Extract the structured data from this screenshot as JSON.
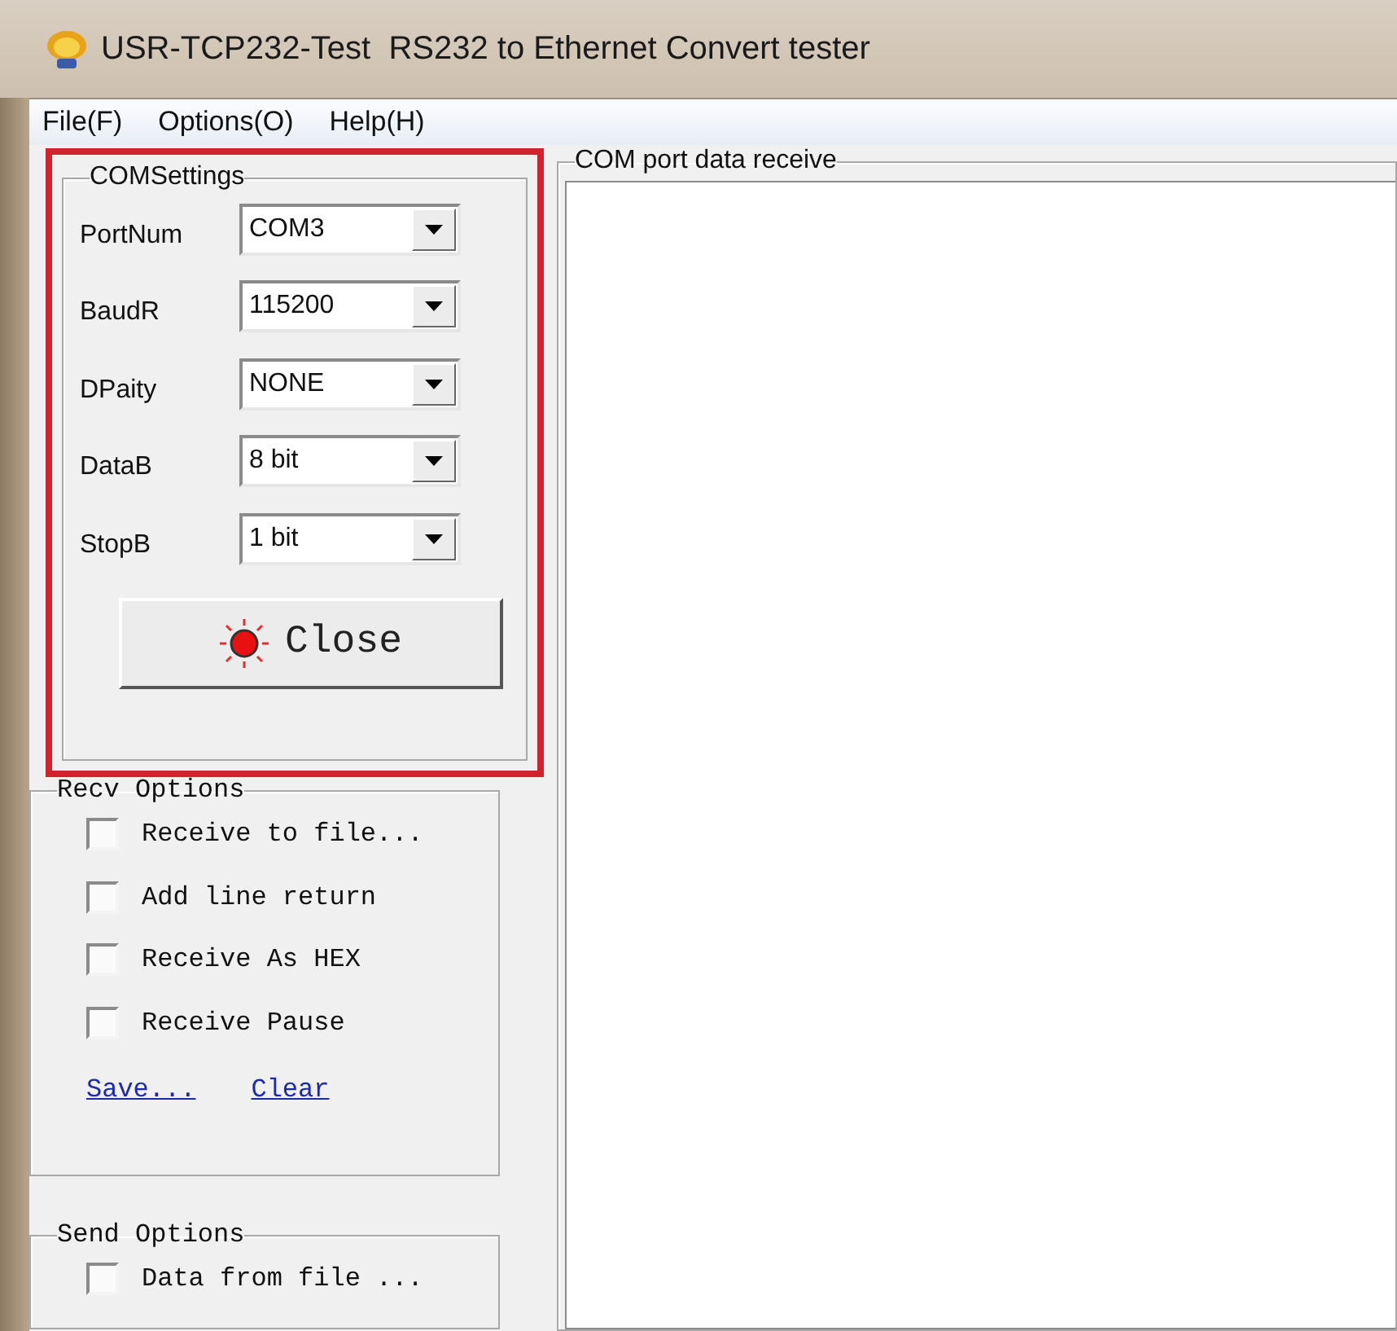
{
  "window": {
    "title": "USR-TCP232-Test  RS232 to Ethernet Convert tester"
  },
  "menu": [
    "File(F)",
    "Options(O)",
    "Help(H)"
  ],
  "com_settings": {
    "title": "COMSettings",
    "fields": [
      {
        "label": "PortNum",
        "value": "COM3"
      },
      {
        "label": "BaudR",
        "value": "115200"
      },
      {
        "label": "DPaity",
        "value": "NONE"
      },
      {
        "label": "DataB",
        "value": "8 bit"
      },
      {
        "label": "StopB",
        "value": "1 bit"
      }
    ],
    "button": {
      "label": "Close"
    }
  },
  "recv_options": {
    "title": "Recv Options",
    "checkboxes": [
      {
        "label": "Receive to file...",
        "checked": false
      },
      {
        "label": "Add line return",
        "checked": false
      },
      {
        "label": "Receive As HEX",
        "checked": false
      },
      {
        "label": "Receive Pause",
        "checked": false
      }
    ],
    "links": [
      "Save...",
      "Clear"
    ]
  },
  "send_options": {
    "title": "Send Options",
    "checkboxes": [
      {
        "label": "Data from file ...",
        "checked": false
      }
    ]
  },
  "receive_panel": {
    "title": "COM port data receive"
  }
}
